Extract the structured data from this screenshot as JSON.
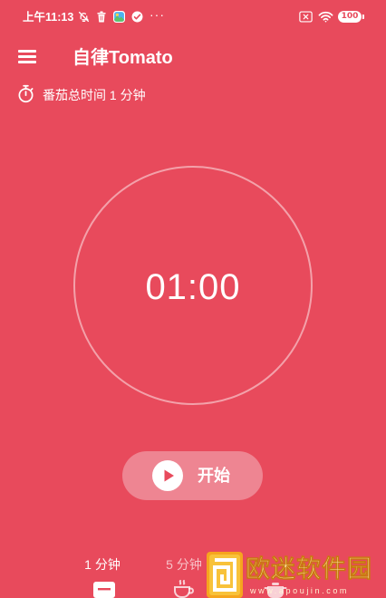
{
  "status_bar": {
    "time": "上午11:13",
    "left_icons": [
      "bell-off-icon",
      "trash-icon",
      "gallery-app-icon",
      "check-circle-icon"
    ],
    "more": "···",
    "right_icons": [
      "no-sim-icon",
      "wifi-icon",
      "battery-icon"
    ],
    "battery": "100"
  },
  "header": {
    "menu_icon": "hamburger-menu-icon",
    "title": "自律Tomato"
  },
  "summary": {
    "icon": "stopwatch-icon",
    "text": "番茄总时间 1 分钟"
  },
  "timer": {
    "display": "01:00"
  },
  "start_button": {
    "icon": "play-icon",
    "label": "开始"
  },
  "tabs": [
    {
      "label": "1 分钟",
      "icon": "note-icon",
      "selected": true
    },
    {
      "label": "5 分钟",
      "icon": "coffee-cup-icon",
      "selected": false
    },
    {
      "icon": "pot-icon",
      "selected": false
    }
  ],
  "colors": {
    "background": "#E84A5C",
    "accent": "#E84A5C",
    "button_bg": "#EE8592",
    "ring": "#F3A1AA",
    "inactive_text": "#F7C2C8"
  },
  "watermark": {
    "name": "欧迷软件园",
    "url": "www.apoujin.com"
  }
}
